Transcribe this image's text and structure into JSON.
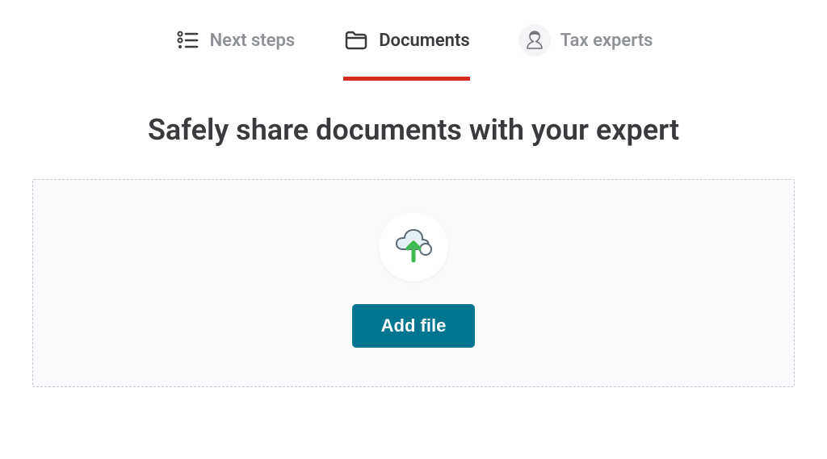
{
  "tabs": {
    "next_steps": {
      "label": "Next steps"
    },
    "documents": {
      "label": "Documents"
    },
    "tax_experts": {
      "label": "Tax experts"
    }
  },
  "main": {
    "heading": "Safely share documents with your expert",
    "add_file_label": "Add file"
  },
  "colors": {
    "accent_red": "#d52b1e",
    "button_teal": "#00758f",
    "text_dark": "#393a3d",
    "text_muted": "#8e9196"
  }
}
